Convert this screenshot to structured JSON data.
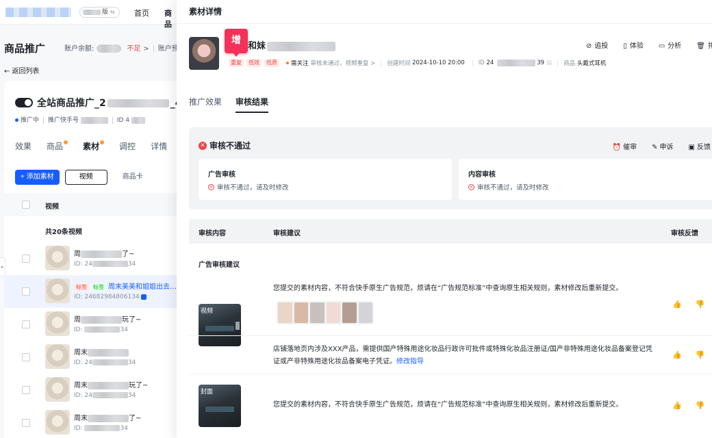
{
  "background_page": {
    "nav": {
      "account_suffix": "版",
      "home": "首页",
      "products": "商品"
    },
    "page_title": "商品推广",
    "balance_label": "账户余额:",
    "balance_warning": "不足",
    "balance_arrow": ">",
    "account_prefix": "账户预",
    "back_link": "← 返回列表",
    "campaign_name_prefix": "全站商品推广_2",
    "campaign_name_suffix": "_4",
    "meta": {
      "status": "推广中",
      "kuaishou_label": "推广快手号",
      "id_label": "ID 4"
    },
    "tabs": [
      "效果",
      "商品",
      "素材",
      "调控",
      "详情"
    ],
    "toolbar": {
      "add": "+ 添加素材",
      "video": "视频",
      "product_card": "商品卡"
    },
    "list_header": "视频",
    "list_count": "共20条视频",
    "rows": [
      {
        "title_pre": "周",
        "title_post": "了~",
        "id": "ID: 24",
        "id_post": "34"
      },
      {
        "tag1": "标签",
        "tag2": "标签",
        "title": "周末美美和姐姐出去…",
        "id": "ID: 24682984806134"
      },
      {
        "title_pre": "周",
        "title_post": "玩了~",
        "id": "ID: ",
        "id_post": "34"
      },
      {
        "title_pre": "周末",
        "title_post": "",
        "id": "ID: 24",
        "id_post": "34"
      },
      {
        "title_pre": "周末",
        "title_post": "玩了~",
        "id": "ID: 24",
        "id_post": "34"
      },
      {
        "title_pre": "周末",
        "title_post": "了~",
        "id": "ID: ",
        "id_post": "34"
      }
    ]
  },
  "drawer": {
    "title": "素材详情",
    "badge": "增",
    "material_name_prefix": "和妹",
    "actions": {
      "track": "追投",
      "experience": "体验",
      "analyze": "分析",
      "delete": "排"
    },
    "tags": [
      "重复",
      "低效",
      "低质"
    ],
    "attention_label": "需关注",
    "attention_detail": "审核未通过、视频重复 >",
    "created_label": "创建时间",
    "created_value": "2024-10-10 20:00",
    "id_label": "ID",
    "id_prefix": "24",
    "id_suffix": "39",
    "product_label": "商品",
    "product_value": "头戴式耳机",
    "tabs": [
      "推广效果",
      "审核结果"
    ],
    "review": {
      "status": "审核不通过",
      "actions": {
        "urge": "催审",
        "appeal": "申诉",
        "feedback": "反馈"
      },
      "ad_review": {
        "title": "广告审核",
        "desc": "审核不通过，请及时修改"
      },
      "content_review": {
        "title": "内容审核",
        "desc": "审核不通过，请及时修改"
      }
    },
    "table": {
      "headers": {
        "content": "审核内容",
        "suggestion": "审核建议",
        "feedback": "审核反馈"
      },
      "section": "广告审核建议",
      "video_label": "视频",
      "cover_label": "封面",
      "suggestion_1": "您提交的素材内容，不符合快手原生广告规范，烦请在“广告规范标准”中查询原生相关规则，素材修改后重新提交。",
      "suggestion_2": "店铺落地页内涉及XXX产品，需提供国产特殊用途化妆品行政许可批件或特殊化妆品注册证/国产非特殊用途化妆品备案登记凭证或产非特殊用途化妆品备案电子凭证。",
      "suggestion_2_link": "修改指导",
      "suggestion_3": "您提交的素材内容，不符合快手原生广告规范，烦请在“广告规范标准”中查询原生相关规则，素材修改后重新提交。"
    }
  },
  "icons": {
    "track": "⊘",
    "experience": "▯",
    "analyze": "▭",
    "delete": "🗑",
    "urge": "⏰",
    "appeal": "✎",
    "feedback": "▣",
    "thumb_up": "👍",
    "thumb_down": "👎"
  }
}
